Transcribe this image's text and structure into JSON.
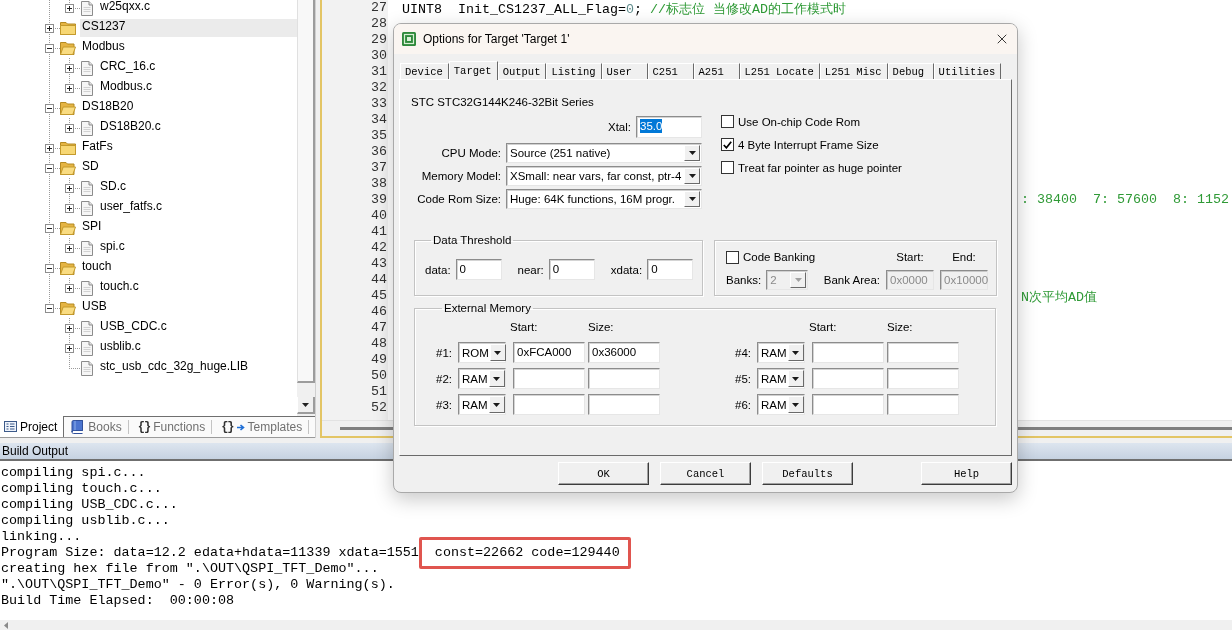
{
  "project_panel": {
    "tree": {
      "files_above": [
        {
          "label": "w25qxx.c",
          "expandable": true,
          "selected": false
        }
      ],
      "groups": [
        {
          "label": "CS1237",
          "expanded": false,
          "selected": true
        },
        {
          "label": "Modbus",
          "expanded": true,
          "selected": false,
          "children": [
            {
              "label": "CRC_16.c",
              "expandable": true,
              "selected": false
            },
            {
              "label": "Modbus.c",
              "expandable": true,
              "selected": false
            }
          ]
        },
        {
          "label": "DS18B20",
          "expanded": true,
          "selected": false,
          "children": [
            {
              "label": "DS18B20.c",
              "expandable": true,
              "selected": false
            }
          ]
        },
        {
          "label": "FatFs",
          "expanded": false,
          "selected": false
        },
        {
          "label": "SD",
          "expanded": true,
          "selected": false,
          "children": [
            {
              "label": "SD.c",
              "expandable": true,
              "selected": false
            },
            {
              "label": "user_fatfs.c",
              "expandable": true,
              "selected": false
            }
          ]
        },
        {
          "label": "SPI",
          "expanded": true,
          "selected": false,
          "children": [
            {
              "label": "spi.c",
              "expandable": true,
              "selected": false
            }
          ]
        },
        {
          "label": "touch",
          "expanded": true,
          "selected": false,
          "children": [
            {
              "label": "touch.c",
              "expandable": true,
              "selected": false
            }
          ]
        },
        {
          "label": "USB",
          "expanded": true,
          "selected": false,
          "children": [
            {
              "label": "USB_CDC.c",
              "expandable": true,
              "selected": false
            },
            {
              "label": "usblib.c",
              "expandable": true,
              "selected": false
            },
            {
              "label": "stc_usb_cdc_32g_huge.LIB",
              "expandable": false,
              "selected": false
            }
          ]
        }
      ]
    },
    "tabs": [
      {
        "label": "Project",
        "selected": true
      },
      {
        "label": "Books",
        "selected": false
      },
      {
        "glyph": "{}",
        "label": "Functions",
        "selected": false
      },
      {
        "glyph": "{}",
        "label": "Templates",
        "selected": false
      }
    ]
  },
  "editor": {
    "lines": [
      {
        "number": "27",
        "kind": "full",
        "segments": [
          {
            "kind": "code",
            "text": "UINT8  Init_CS1237_ALL_Flag="
          },
          {
            "kind": "number",
            "text": "0"
          },
          {
            "kind": "code",
            "text": "; "
          },
          {
            "kind": "comment",
            "text": "//标志位 当修改AD的工作模式时"
          }
        ]
      },
      {
        "number": "28"
      },
      {
        "number": "29"
      },
      {
        "number": "30"
      },
      {
        "number": "31"
      },
      {
        "number": "32"
      },
      {
        "number": "33"
      },
      {
        "number": "34"
      },
      {
        "number": "35"
      },
      {
        "number": "36"
      },
      {
        "number": "37"
      },
      {
        "number": "38"
      },
      {
        "number": "39",
        "kind": "right_of_dialog",
        "segments": [
          {
            "kind": "comment",
            "text": ": 38400  7: 57600  8: 1152"
          }
        ]
      },
      {
        "number": "40"
      },
      {
        "number": "41"
      },
      {
        "number": "42"
      },
      {
        "number": "43"
      },
      {
        "number": "44"
      },
      {
        "number": "45",
        "kind": "right_of_dialog",
        "segments": [
          {
            "kind": "comment",
            "text": "N次平均AD值"
          }
        ]
      },
      {
        "number": "46"
      },
      {
        "number": "47"
      },
      {
        "number": "48"
      },
      {
        "number": "49"
      },
      {
        "number": "50"
      },
      {
        "number": "51"
      },
      {
        "number": "52"
      }
    ]
  },
  "build_output": {
    "title": "Build Output",
    "lines": [
      {
        "text": "compiling spi.c..."
      },
      {
        "text": "compiling touch.c..."
      },
      {
        "text": "compiling USB_CDC.c..."
      },
      {
        "text": "compiling usblib.c..."
      },
      {
        "text": "linking..."
      },
      {
        "text": "Program Size: data=12.2 edata+hdata=11339 xdata=1551",
        "highlight": "const=22662 code=129440"
      },
      {
        "text": "creating hex file from \".\\OUT\\QSPI_TFT_Demo\"..."
      },
      {
        "text": "\".\\OUT\\QSPI_TFT_Demo\" - 0 Error(s), 0 Warning(s)."
      },
      {
        "text": "Build Time Elapsed:  00:00:08"
      }
    ]
  },
  "dialog": {
    "title": "Options for Target 'Target 1'",
    "tabs": [
      {
        "label": "Device",
        "selected": false
      },
      {
        "label": "Target",
        "selected": true
      },
      {
        "label": "Output",
        "selected": false
      },
      {
        "label": "Listing",
        "selected": false
      },
      {
        "label": "User",
        "selected": false
      },
      {
        "label": "C251",
        "selected": false
      },
      {
        "label": "A251",
        "selected": false
      },
      {
        "label": "L251 Locate",
        "selected": false
      },
      {
        "label": "L251 Misc",
        "selected": false
      },
      {
        "label": "Debug",
        "selected": false
      },
      {
        "label": "Utilities",
        "selected": false
      }
    ],
    "target": {
      "device": "STC STC32G144K246-32Bit Series",
      "xtal": {
        "label": "Xtal:",
        "value": "35.0",
        "text_selected": true
      },
      "dropdowns": [
        {
          "label": "CPU Mode:",
          "value": "Source (251 native)"
        },
        {
          "label": "Memory Model:",
          "value": "XSmall: near vars, far const, ptr-4"
        },
        {
          "label": "Code Rom Size:",
          "value": "Huge: 64K functions, 16M progr."
        }
      ],
      "options": [
        {
          "label": "Use On-chip Code Rom",
          "checked": false
        },
        {
          "label": "4 Byte Interrupt Frame Size",
          "checked": true
        },
        {
          "label": "Treat far pointer as huge pointer",
          "checked": false
        }
      ],
      "data_threshold": {
        "title": "Data Threshold",
        "fields": [
          {
            "label": "data:",
            "value": "0"
          },
          {
            "label": "near:",
            "value": "0"
          },
          {
            "label": "xdata:",
            "value": "0"
          }
        ]
      },
      "code_banking": {
        "label": "Code Banking",
        "checked": false,
        "start_header": "Start:",
        "end_header": "End:",
        "banks": {
          "label": "Banks:",
          "value": "2",
          "disabled": true
        },
        "bank_area": {
          "label": "Bank Area:",
          "start": "0x0000",
          "end": "0x10000",
          "disabled": true
        }
      },
      "external_memory": {
        "title": "External Memory",
        "columns": [
          {
            "start_header": "Start:",
            "size_header": "Size:",
            "rows": [
              {
                "label": "#1:",
                "memory_type": "ROM",
                "start": "0xFCA000",
                "size": "0x36000"
              },
              {
                "label": "#2:",
                "memory_type": "RAM"
              },
              {
                "label": "#3:",
                "memory_type": "RAM"
              }
            ]
          },
          {
            "start_header": "Start:",
            "size_header": "Size:",
            "rows": [
              {
                "label": "#4:",
                "memory_type": "RAM"
              },
              {
                "label": "#5:",
                "memory_type": "RAM"
              },
              {
                "label": "#6:",
                "memory_type": "RAM"
              }
            ]
          }
        ]
      }
    },
    "buttons": [
      {
        "label": "OK"
      },
      {
        "label": "Cancel"
      },
      {
        "label": "Defaults"
      },
      {
        "label": "Help"
      }
    ]
  }
}
